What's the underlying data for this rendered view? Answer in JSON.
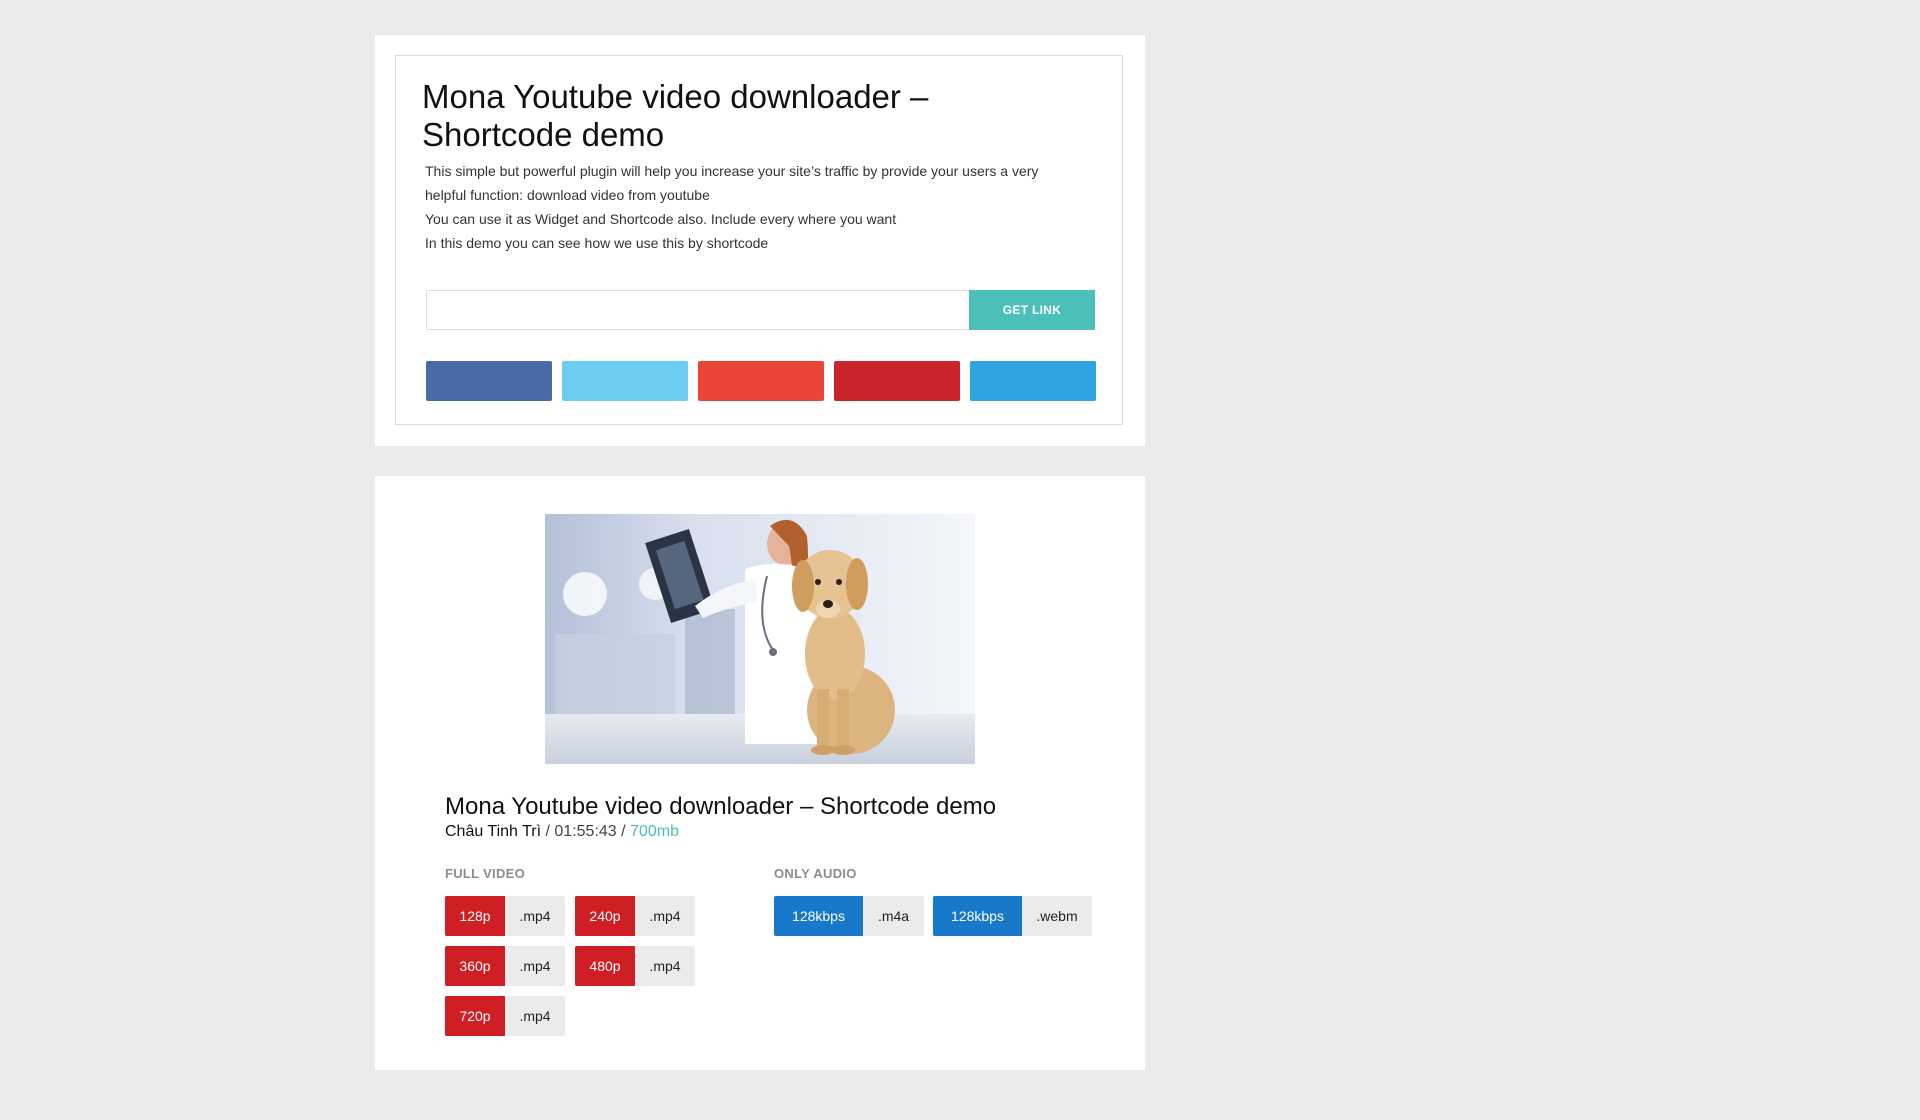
{
  "form_panel": {
    "title": "Mona Youtube video downloader – Shortcode demo",
    "description": [
      "This simple but powerful plugin will help you increase your site’s traffic by provide your users a very",
      "helpful function: download video from youtube",
      "You can use it as Widget and Shortcode also. Include every where you want",
      "In this demo you can see how we use this by shortcode"
    ],
    "url_input": {
      "value": "",
      "placeholder": ""
    },
    "get_link_label": "GET LINK",
    "share_buttons": [
      {
        "icon": "facebook-share-icon",
        "color": "#4a69a7"
      },
      {
        "icon": "twitter-share-icon",
        "color": "#6bcdf1"
      },
      {
        "icon": "google-plus-share-icon",
        "color": "#eb4537"
      },
      {
        "icon": "pinterest-share-icon",
        "color": "#cb232c"
      },
      {
        "icon": "telegram-share-icon",
        "color": "#2ea3e0"
      }
    ]
  },
  "result_panel": {
    "video_title": "Mona Youtube video downloader – Shortcode demo",
    "author": "Châu Tinh Trì",
    "separator": "/",
    "duration": "01:55:43",
    "size": "700mb",
    "full_video": {
      "label": "FULL VIDEO",
      "options": [
        {
          "quality": "128p",
          "ext": ".mp4"
        },
        {
          "quality": "240p",
          "ext": ".mp4"
        },
        {
          "quality": "360p",
          "ext": ".mp4"
        },
        {
          "quality": "480p",
          "ext": ".mp4"
        },
        {
          "quality": "720p",
          "ext": ".mp4"
        }
      ]
    },
    "only_audio": {
      "label": "ONLY AUDIO",
      "options": [
        {
          "quality": "128kbps",
          "ext": ".m4a"
        },
        {
          "quality": "128kbps",
          "ext": ".webm"
        }
      ]
    }
  },
  "colors": {
    "accent_teal": "#4bbfba",
    "video_red": "#cf1f25",
    "audio_blue": "#1878c9",
    "page_background": "#ebebeb"
  }
}
